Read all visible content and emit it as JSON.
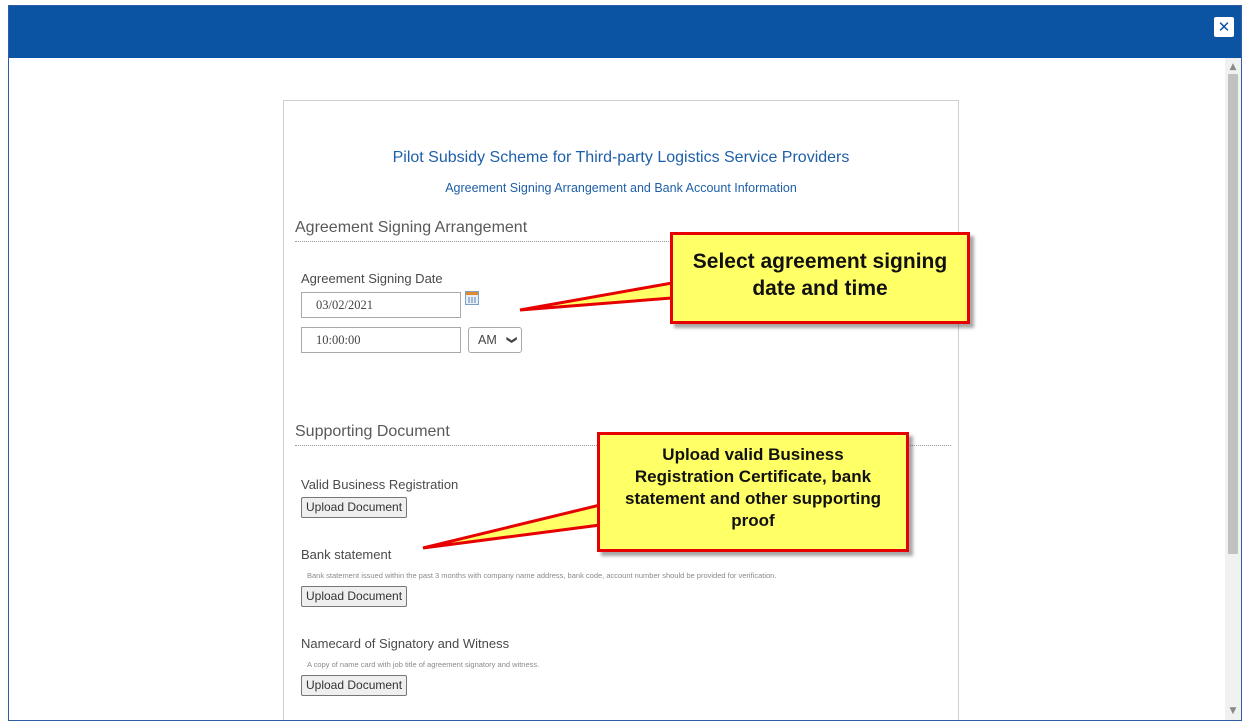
{
  "window": {
    "close_glyph": "✕"
  },
  "scrollbar": {
    "up": "▲",
    "down": "▼"
  },
  "form": {
    "title": "Pilot Subsidy Scheme for Third-party Logistics Service Providers",
    "subtitle": "Agreement Signing Arrangement and Bank Account Information",
    "signing_section": {
      "heading": "Agreement Signing Arrangement",
      "date_label": "Agreement Signing Date",
      "date_value": "03/02/2021",
      "time_value": "10:00:00",
      "ampm_value": "AM"
    },
    "documents_section": {
      "heading": "Supporting Document",
      "items": [
        {
          "label": "Valid Business Registration",
          "hint": "",
          "button": "Upload Document"
        },
        {
          "label": "Bank statement",
          "hint": "Bank statement issued within the past 3 months with company name address, bank code, account number should be provided for verification.",
          "button": "Upload Document"
        },
        {
          "label": "Namecard of Signatory and Witness",
          "hint": "A copy of name card with job title of agreement signatory and witness.",
          "button": "Upload Document"
        }
      ]
    }
  },
  "callouts": {
    "date_time": "Select agreement signing date and time",
    "documents": "Upload valid Business Registration Certificate, bank statement and other supporting proof"
  },
  "colors": {
    "titlebar": "#0b54a4",
    "link_blue": "#1f5fa8",
    "callout_fill": "#ffff66",
    "callout_border": "#e60000"
  }
}
